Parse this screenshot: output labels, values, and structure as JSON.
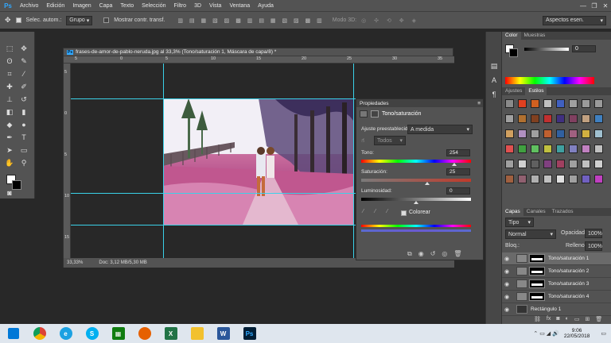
{
  "menubar": {
    "logo": "Ps",
    "items": [
      "Archivo",
      "Edición",
      "Imagen",
      "Capa",
      "Texto",
      "Selección",
      "Filtro",
      "3D",
      "Vista",
      "Ventana",
      "Ayuda"
    ],
    "controls": [
      "—",
      "❐",
      "✕"
    ]
  },
  "options": {
    "auto_select_label": "Selec. autom.:",
    "auto_select_value": "Grupo",
    "transform_label": "Mostrar contr. transf.",
    "mode3d_label": "Modo 3D:",
    "workspace": "Aspectos esen."
  },
  "document": {
    "title": "frases-de-amor-de-pablo-neruda.jpg al 33,3% (Tono/saturación 1, Máscara de capa/8) *",
    "zoom": "33,33%",
    "doc_size": "Doc: 3,12 MB/5,30 MB",
    "ruler_top": [
      "5",
      "0",
      "5",
      "10",
      "15",
      "20",
      "25",
      "30",
      "35"
    ],
    "ruler_left": [
      "5",
      "0",
      "5",
      "10",
      "15"
    ]
  },
  "properties": {
    "tab": "Propiedades",
    "title": "Tono/saturación",
    "preset_label": "Ajuste preestablecido:",
    "preset_value": "A medida",
    "channel": "Todos",
    "hue_label": "Tono:",
    "hue_value": "254",
    "hue_level": 0.85,
    "sat_label": "Saturación:",
    "sat_value": "25",
    "sat_level": 0.6,
    "light_label": "Luminosidad:",
    "light_value": "0",
    "light_level": 0.5,
    "colorize_label": "Colorear"
  },
  "color_panel": {
    "tabs": [
      "Color",
      "Muestras"
    ],
    "value": "0"
  },
  "styles_panel": {
    "tabs": [
      "Ajustes",
      "Estilos"
    ]
  },
  "layers_panel": {
    "tabs": [
      "Capas",
      "Canales",
      "Trazados"
    ],
    "filter": "Tipo",
    "blend": "Normal",
    "opacity_label": "Opacidad:",
    "opacity": "100%",
    "fill_label": "Relleno:",
    "fill": "100%",
    "lock_label": "Bloq.:",
    "layers": [
      {
        "name": "Tono/saturación 1"
      },
      {
        "name": "Tono/saturación 2"
      },
      {
        "name": "Tono/saturación 3"
      },
      {
        "name": "Tono/saturación 4"
      },
      {
        "name": "Rectángulo 1"
      }
    ]
  },
  "taskbar": {
    "time": "9:06",
    "date": "22/05/2018",
    "apps": [
      "windows",
      "chrome",
      "ie",
      "skype",
      "store",
      "firefox",
      "excel",
      "explorer",
      "word",
      "photoshop"
    ]
  }
}
